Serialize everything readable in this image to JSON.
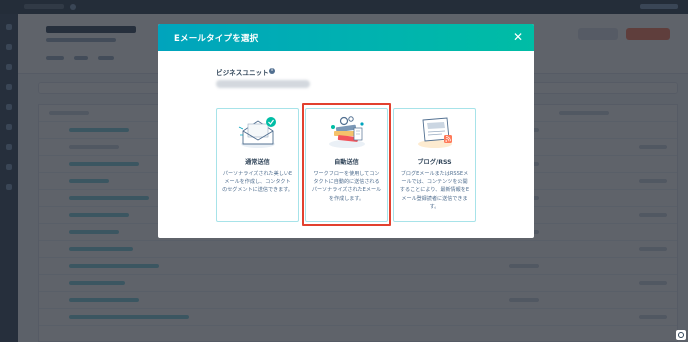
{
  "modal": {
    "title": "Eメールタイプを選択",
    "close_icon": "close-icon",
    "business_unit_label": "ビジネスユニット",
    "info_icon": "i",
    "cards": [
      {
        "title": "通常送信",
        "description": "パーソナライズされた美しいEメールを作成し、コンタクトのセグメントに送信できます。",
        "illustration": "envelope-check-icon"
      },
      {
        "title": "自動送信",
        "description": "ワークフローを使用してコンタクトに自動的に送信されるパーソナライズされたEメールを作成します。",
        "illustration": "workflow-gears-icon"
      },
      {
        "title": "ブログ/RSS",
        "description": "ブログEメールまたはRSSEメールでは、コンテンツを公開することにより、最新情報をEメール登録読者に送信できます。",
        "illustration": "blog-rss-icon"
      }
    ]
  },
  "colors": {
    "header_gradient_start": "#00a4bd",
    "header_gradient_end": "#00bda5",
    "card_border": "#a7e3e9",
    "highlight": "#e2412f"
  }
}
